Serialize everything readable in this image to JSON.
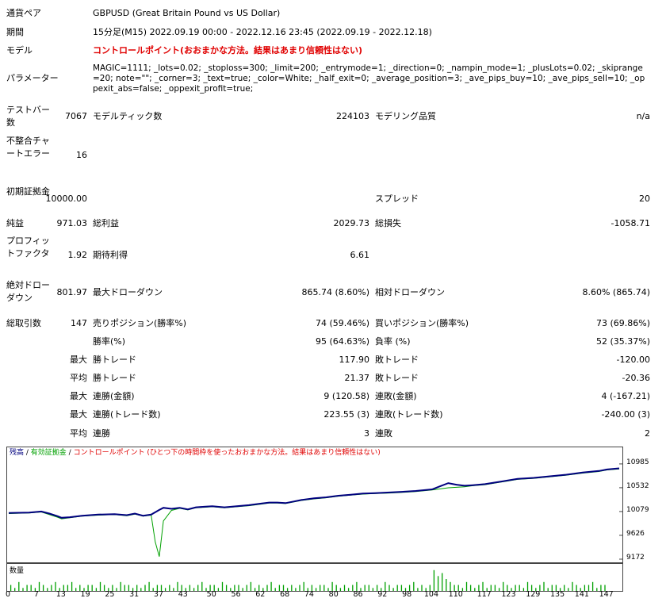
{
  "header": {
    "pair_label": "通貨ペア",
    "pair_value": "GBPUSD (Great Britain Pound vs US Dollar)",
    "period_label": "期間",
    "period_value": "15分足(M15) 2022.09.19 00:00 - 2022.12.16 23:45 (2022.09.19 - 2022.12.18)",
    "model_label": "モデル",
    "model_value": "コントロールポイント(おおまかな方法。結果はあまり信頼性はない)",
    "params_label": "パラメーター",
    "params_value": "MAGIC=1111; _lots=0.02; _stoploss=300; _limit=200; _entrymode=1; _direction=0; _nampin_mode=1; _plusLots=0.02; _skiprange=20; note=\"\"; _corner=3; _text=true; _color=White; _half_exit=0; _average_position=3; _ave_pips_buy=10; _ave_pips_sell=10; _oppexit_abs=false; _oppexit_profit=true;"
  },
  "stats": {
    "bars_label": "テストバー数",
    "bars_value": "7067",
    "ticks_label": "モデルティック数",
    "ticks_value": "224103",
    "quality_label": "モデリング品質",
    "quality_value": "n/a",
    "mismatch_label": "不整合チャートエラー",
    "mismatch_value": "16",
    "deposit_label": "初期証拠金",
    "deposit_value": "10000.00",
    "spread_label": "スプレッド",
    "spread_value": "20",
    "net_label": "純益",
    "net_value": "971.03",
    "gross_profit_label": "総利益",
    "gross_profit_value": "2029.73",
    "gross_loss_label": "総損失",
    "gross_loss_value": "-1058.71",
    "pf_label": "プロフィットファクタ",
    "pf_value": "1.92",
    "expected_label": "期待利得",
    "expected_value": "6.61",
    "abs_dd_label": "絶対ドローダウン",
    "abs_dd_value": "801.97",
    "max_dd_label": "最大ドローダウン",
    "max_dd_value": "865.74 (8.60%)",
    "rel_dd_label": "相対ドローダウン",
    "rel_dd_value": "8.60% (865.74)",
    "trades_label": "総取引数",
    "trades_value": "147",
    "short_label": "売りポジション(勝率%)",
    "short_value": "74 (59.46%)",
    "long_label": "買いポジション(勝率%)",
    "long_value": "73 (69.86%)",
    "win_label": "勝率(%)",
    "win_value": "95 (64.63%)",
    "loss_label": "負率 (%)",
    "loss_value": "52 (35.37%)",
    "max_word": "最大",
    "avg_word": "平均",
    "max_win_label": "勝トレード",
    "max_win_value": "117.90",
    "max_loss_label": "敗トレード",
    "max_loss_value": "-120.00",
    "avg_win_label": "勝トレード",
    "avg_win_value": "21.37",
    "avg_loss_label": "敗トレード",
    "avg_loss_value": "-20.36",
    "consec_win_money_label": "連勝(金額)",
    "consec_win_money_value": "9 (120.58)",
    "consec_loss_money_label": "連敗(金額)",
    "consec_loss_money_value": "4 (-167.21)",
    "consec_win_trades_label": "連勝(トレード数)",
    "consec_win_trades_value": "223.55 (3)",
    "consec_loss_trades_label": "連敗(トレード数)",
    "consec_loss_trades_value": "-240.00 (3)",
    "avg_consec_win_label": "連勝",
    "avg_consec_win_value": "3",
    "avg_consec_loss_label": "連敗",
    "avg_consec_loss_value": "2"
  },
  "chart_legend": {
    "balance": "残高",
    "sep1": " / ",
    "equity": "有効証拠金",
    "sep2": " / ",
    "note": "コントロールポイント (ひとつ下の時間枠を使ったおおまかな方法。結果はあまり信頼性はない)"
  },
  "volume_label": "数量",
  "colors": {
    "balance": "#00007f",
    "equity": "#00a000",
    "volume": "#00a000",
    "note": "#e00000"
  },
  "chart_data": {
    "type": "line",
    "ylim": [
      9172,
      11210
    ],
    "yticks": [
      "10985",
      "10532",
      "10079",
      "9626",
      "9172"
    ],
    "xticks": [
      "0",
      "7",
      "13",
      "19",
      "25",
      "31",
      "37",
      "43",
      "50",
      "56",
      "62",
      "68",
      "74",
      "80",
      "86",
      "92",
      "98",
      "104",
      "110",
      "117",
      "123",
      "129",
      "135",
      "141",
      "147"
    ],
    "xlim": [
      0,
      150
    ],
    "series": [
      {
        "name": "残高",
        "x": [
          0,
          5,
          8,
          10,
          12,
          13,
          15,
          18,
          22,
          26,
          29,
          31,
          33,
          35,
          37,
          38,
          40,
          42,
          44,
          46,
          48,
          50,
          53,
          56,
          59,
          62,
          64,
          66,
          68,
          70,
          72,
          75,
          78,
          81,
          84,
          87,
          90,
          93,
          96,
          100,
          104,
          106,
          108,
          110,
          112,
          114,
          117,
          121,
          125,
          129,
          133,
          137,
          141,
          145,
          147,
          150
        ],
        "values": [
          10050,
          10060,
          10080,
          10040,
          9990,
          9960,
          9970,
          10000,
          10020,
          10030,
          10010,
          10040,
          10000,
          10020,
          10110,
          10150,
          10130,
          10150,
          10120,
          10160,
          10170,
          10180,
          10160,
          10180,
          10200,
          10230,
          10250,
          10250,
          10240,
          10270,
          10300,
          10330,
          10350,
          10380,
          10400,
          10420,
          10430,
          10440,
          10450,
          10470,
          10500,
          10560,
          10620,
          10590,
          10570,
          10580,
          10600,
          10650,
          10700,
          10720,
          10750,
          10780,
          10820,
          10850,
          10880,
          10900
        ]
      },
      {
        "name": "有効証拠金",
        "x": [
          0,
          5,
          8,
          10,
          12,
          13,
          15,
          18,
          22,
          26,
          29,
          31,
          33,
          35,
          36,
          37,
          38,
          40,
          42,
          44,
          46,
          48,
          50,
          53,
          56,
          59,
          62,
          64,
          66,
          68,
          70,
          72,
          75,
          78,
          81,
          84,
          87,
          90,
          93,
          96,
          100,
          104,
          106,
          108,
          110,
          112,
          114,
          117,
          121,
          125,
          129,
          133,
          137,
          141,
          145,
          147,
          150
        ],
        "values": [
          10040,
          10050,
          10070,
          10020,
          9970,
          9940,
          9960,
          9990,
          10010,
          10020,
          10000,
          10030,
          9990,
          10010,
          9500,
          9220,
          9900,
          10100,
          10140,
          10110,
          10150,
          10160,
          10170,
          10150,
          10170,
          10190,
          10220,
          10240,
          10240,
          10230,
          10260,
          10290,
          10320,
          10340,
          10370,
          10390,
          10410,
          10420,
          10430,
          10440,
          10460,
          10490,
          10510,
          10530,
          10540,
          10550,
          10570,
          10590,
          10640,
          10690,
          10710,
          10740,
          10770,
          10810,
          10840,
          10870,
          10890
        ]
      }
    ],
    "volume": [
      2,
      1,
      3,
      1,
      2,
      2,
      1,
      3,
      2,
      1,
      2,
      3,
      1,
      2,
      2,
      3,
      1,
      2,
      1,
      2,
      2,
      1,
      3,
      2,
      1,
      2,
      1,
      3,
      2,
      2,
      1,
      2,
      1,
      2,
      3,
      1,
      2,
      2,
      1,
      2,
      1,
      3,
      2,
      1,
      2,
      1,
      2,
      3,
      1,
      2,
      2,
      1,
      3,
      2,
      1,
      2,
      2,
      1,
      2,
      3,
      1,
      2,
      1,
      2,
      3,
      1,
      2,
      2,
      1,
      2,
      1,
      2,
      3,
      1,
      2,
      1,
      2,
      2,
      1,
      3,
      2,
      1,
      2,
      1,
      2,
      3,
      1,
      2,
      2,
      1,
      2,
      1,
      3,
      2,
      1,
      2,
      2,
      1,
      2,
      3,
      1,
      2,
      1,
      2,
      7,
      5,
      6,
      4,
      3,
      2,
      2,
      1,
      3,
      2,
      1,
      2,
      3,
      1,
      2,
      2,
      1,
      3,
      2,
      1,
      2,
      2,
      1,
      3,
      2,
      1,
      2,
      3,
      1,
      2,
      2,
      1,
      2,
      1,
      3,
      2,
      1,
      2,
      2,
      3,
      1,
      2,
      2
    ]
  }
}
